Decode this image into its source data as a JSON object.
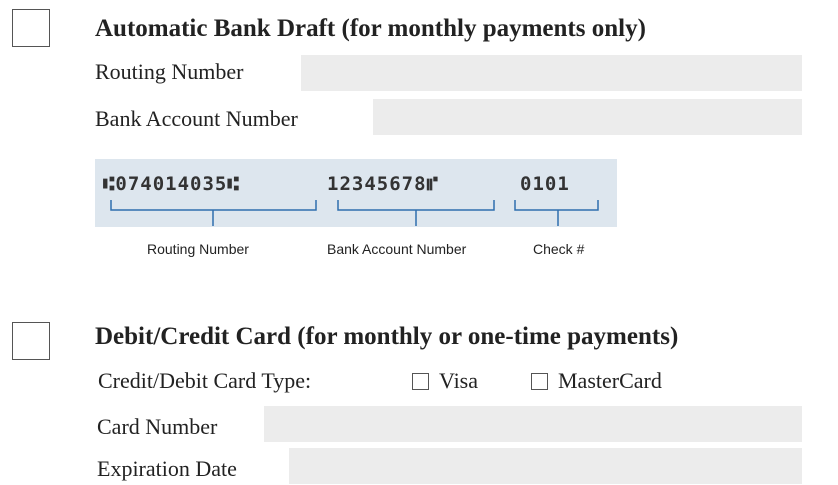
{
  "bank_draft": {
    "title": "Automatic Bank Draft (for monthly payments only)",
    "routing_label": "Routing Number",
    "account_label": "Bank Account Number",
    "routing_value": "",
    "account_value": ""
  },
  "check_diagram": {
    "micr_routing": "⑆074014035⑆",
    "micr_account": "12345678⑈",
    "micr_check": "0101",
    "routing_caption": "Routing Number",
    "account_caption": "Bank Account Number",
    "check_caption": "Check #",
    "bracket_color": "#2f6fae"
  },
  "card_payment": {
    "title": "Debit/Credit Card (for monthly or one-time payments)",
    "type_label": "Credit/Debit Card Type:",
    "visa_label": "Visa",
    "mastercard_label": "MasterCard",
    "card_number_label": "Card Number",
    "expiration_label": "Expiration Date",
    "card_number_value": "",
    "expiration_value": ""
  }
}
